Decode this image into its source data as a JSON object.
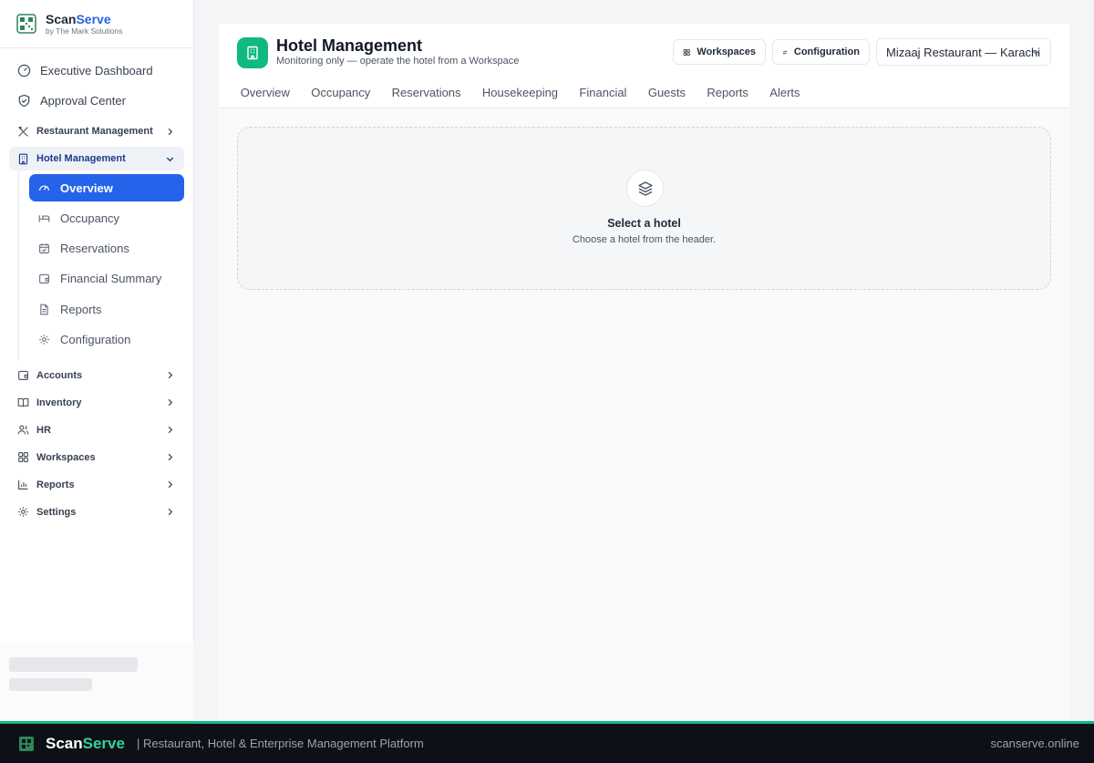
{
  "brand": {
    "name_part1": "Scan",
    "name_part2": "Serve",
    "subtitle": "by The Mark Solutions"
  },
  "sidebar": {
    "top_items": [
      {
        "label": "Executive Dashboard",
        "icon": "gauge-icon"
      },
      {
        "label": "Approval Center",
        "icon": "shield-check-icon"
      }
    ],
    "sections": {
      "restaurant": {
        "label": "Restaurant Management",
        "icon": "utensils-icon"
      },
      "hotel": {
        "label": "Hotel Management",
        "icon": "building-icon",
        "expanded": true,
        "items": [
          {
            "label": "Overview",
            "icon": "gauge-icon",
            "active": true
          },
          {
            "label": "Occupancy",
            "icon": "bed-icon"
          },
          {
            "label": "Reservations",
            "icon": "calendar-check-icon"
          },
          {
            "label": "Financial Summary",
            "icon": "wallet-icon"
          },
          {
            "label": "Reports",
            "icon": "file-icon"
          },
          {
            "label": "Configuration",
            "icon": "gear-icon"
          }
        ]
      },
      "accounts": {
        "label": "Accounts",
        "icon": "wallet-icon"
      },
      "inventory": {
        "label": "Inventory",
        "icon": "book-open-icon"
      },
      "hr": {
        "label": "HR",
        "icon": "users-icon"
      },
      "workspaces": {
        "label": "Workspaces",
        "icon": "grid-icon"
      },
      "reports": {
        "label": "Reports",
        "icon": "bar-chart-icon"
      },
      "settings": {
        "label": "Settings",
        "icon": "gear-icon"
      }
    }
  },
  "header": {
    "title": "Hotel Management",
    "subtitle": "Monitoring only — operate the hotel from a Workspace",
    "workspaces_button": "Workspaces",
    "configuration_button": "Configuration",
    "selected_location": "Mizaaj Restaurant — Karachi",
    "accent_color": "#10b981"
  },
  "tabs": [
    "Overview",
    "Occupancy",
    "Reservations",
    "Housekeeping",
    "Financial",
    "Guests",
    "Reports",
    "Alerts"
  ],
  "empty_state": {
    "icon": "layers-icon",
    "title": "Select a hotel",
    "message": "Choose a hotel from the header."
  },
  "footer": {
    "brand_part1": "Scan",
    "brand_part2": "Serve",
    "tagline": "| Restaurant, Hotel & Enterprise Management Platform",
    "url": "scanserve.online"
  },
  "colors": {
    "primary": "#2563eb",
    "brand_green": "#10b981",
    "footer_bg": "#0d1117"
  }
}
